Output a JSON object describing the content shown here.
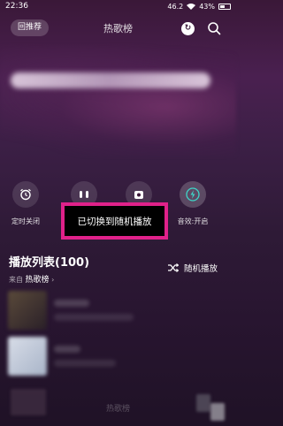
{
  "status_bar": {
    "time": "22:36",
    "network": "46.2",
    "battery": "43%"
  },
  "header": {
    "back_label": "回推荐",
    "title": "热歌榜",
    "icons": [
      "share-icon",
      "search-icon"
    ]
  },
  "controls": [
    {
      "icon": "alarm-clock-icon",
      "label": "定时关闭"
    },
    {
      "icon": "earbuds-icon",
      "label": ""
    },
    {
      "icon": "radio-icon",
      "label": ""
    },
    {
      "icon": "lightning-icon",
      "label": "音效:开启"
    }
  ],
  "toast": {
    "text": "已切换到随机播放"
  },
  "playlist": {
    "title": "播放列表(100)",
    "source_prefix": "来自",
    "source_name": "热歌榜",
    "source_chevron": "›",
    "shuffle_label": "随机播放"
  },
  "footer": {
    "title": "热歌榜"
  },
  "colors": {
    "toast_border": "#e0218a",
    "toast_bg": "#000000",
    "background": "#3a1838"
  }
}
